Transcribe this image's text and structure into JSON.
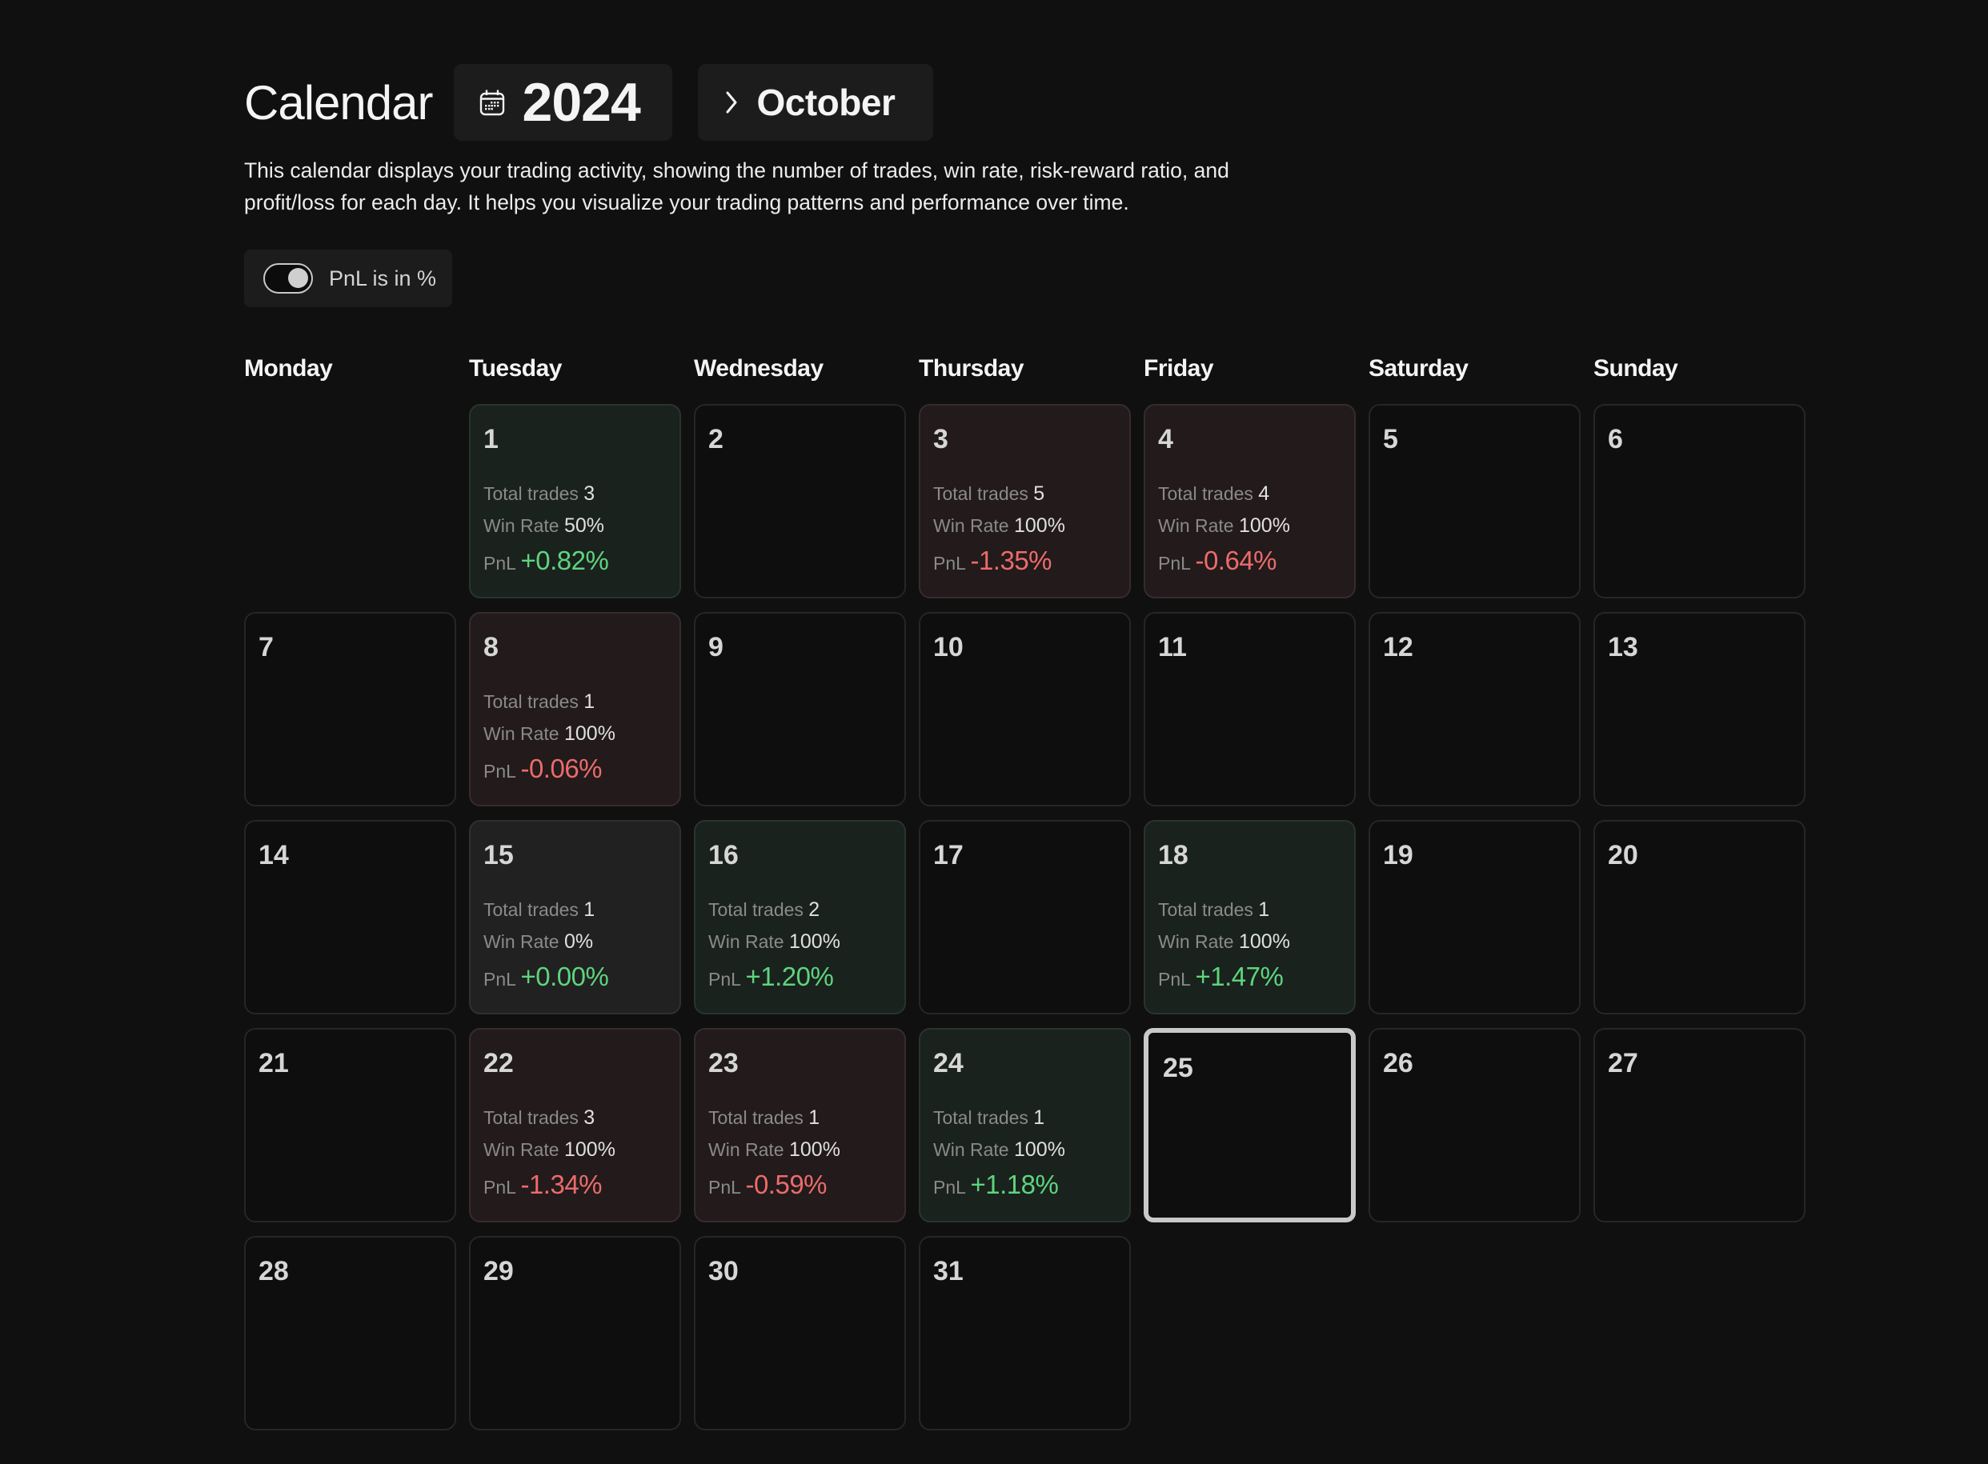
{
  "header": {
    "title": "Calendar",
    "year": "2024",
    "year_icon": "calendar-icon",
    "month": "October",
    "month_icon": "chevron-right-icon"
  },
  "description": "This calendar displays your trading activity, showing the number of trades, win rate, risk-reward ratio, and profit/loss for each day. It helps you visualize your trading patterns and performance over time.",
  "toggle": {
    "label": "PnL is in %",
    "checked": true
  },
  "labels": {
    "total_trades": "Total trades",
    "win_rate": "Win Rate",
    "pnl": "PnL"
  },
  "colors": {
    "positive": "#5ed47e",
    "negative": "#ec6b6b",
    "win_bg": "#1a221d",
    "loss_bg": "#221a1b"
  },
  "weekdays": [
    "Monday",
    "Tuesday",
    "Wednesday",
    "Thursday",
    "Friday",
    "Saturday",
    "Sunday"
  ],
  "first_weekday_offset": 1,
  "today": 25,
  "days": [
    {
      "day": "1",
      "status": "win",
      "total_trades": "3",
      "win_rate": "50%",
      "pnl": "+0.82%"
    },
    {
      "day": "2"
    },
    {
      "day": "3",
      "status": "loss",
      "total_trades": "5",
      "win_rate": "100%",
      "pnl": "-1.35%"
    },
    {
      "day": "4",
      "status": "loss",
      "total_trades": "4",
      "win_rate": "100%",
      "pnl": "-0.64%"
    },
    {
      "day": "5"
    },
    {
      "day": "6"
    },
    {
      "day": "7"
    },
    {
      "day": "8",
      "status": "loss",
      "total_trades": "1",
      "win_rate": "100%",
      "pnl": "-0.06%"
    },
    {
      "day": "9"
    },
    {
      "day": "10"
    },
    {
      "day": "11"
    },
    {
      "day": "12"
    },
    {
      "day": "13"
    },
    {
      "day": "14"
    },
    {
      "day": "15",
      "status": "neutral",
      "total_trades": "1",
      "win_rate": "0%",
      "pnl": "+0.00%"
    },
    {
      "day": "16",
      "status": "win",
      "total_trades": "2",
      "win_rate": "100%",
      "pnl": "+1.20%"
    },
    {
      "day": "17"
    },
    {
      "day": "18",
      "status": "win",
      "total_trades": "1",
      "win_rate": "100%",
      "pnl": "+1.47%"
    },
    {
      "day": "19"
    },
    {
      "day": "20"
    },
    {
      "day": "21"
    },
    {
      "day": "22",
      "status": "loss",
      "total_trades": "3",
      "win_rate": "100%",
      "pnl": "-1.34%"
    },
    {
      "day": "23",
      "status": "loss",
      "total_trades": "1",
      "win_rate": "100%",
      "pnl": "-0.59%"
    },
    {
      "day": "24",
      "status": "win",
      "total_trades": "1",
      "win_rate": "100%",
      "pnl": "+1.18%"
    },
    {
      "day": "25"
    },
    {
      "day": "26"
    },
    {
      "day": "27"
    },
    {
      "day": "28"
    },
    {
      "day": "29"
    },
    {
      "day": "30"
    },
    {
      "day": "31"
    }
  ]
}
